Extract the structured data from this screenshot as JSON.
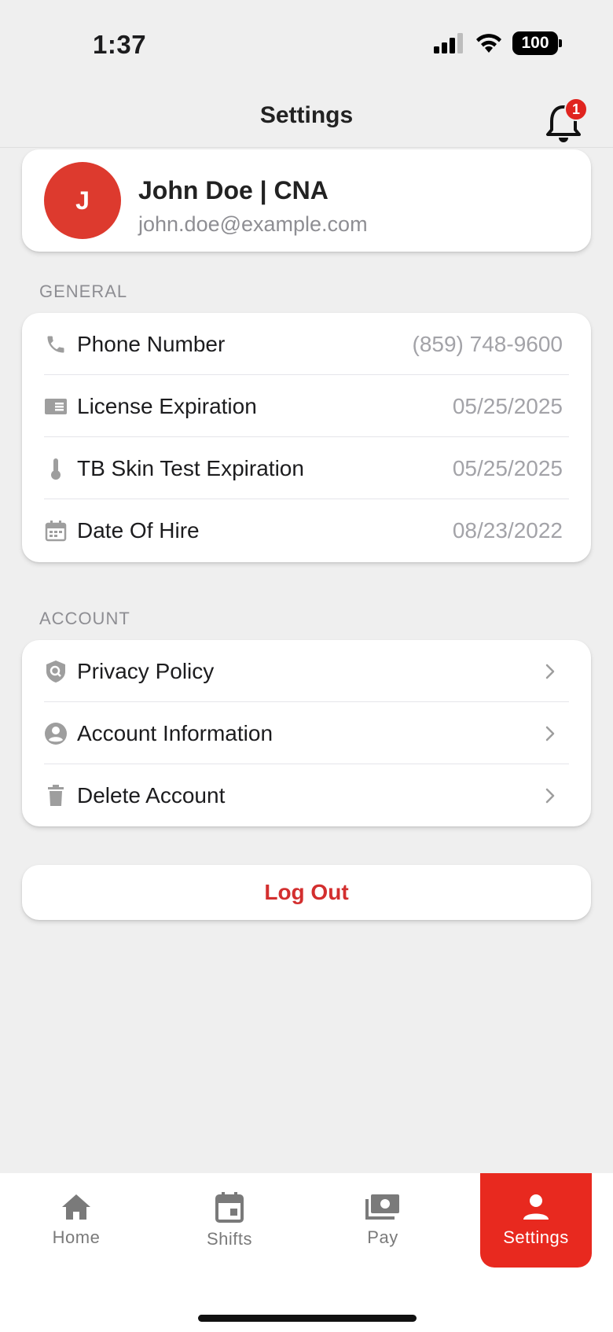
{
  "status_bar": {
    "time": "1:37",
    "battery": "100"
  },
  "header": {
    "title": "Settings",
    "notification_count": "1"
  },
  "profile": {
    "initial": "J",
    "name": "John Doe | CNA",
    "email": "john.doe@example.com"
  },
  "general": {
    "label": "GENERAL",
    "items": [
      {
        "icon": "phone-icon",
        "label": "Phone Number",
        "value": "(859) 748-9600"
      },
      {
        "icon": "license-card-icon",
        "label": "License Expiration",
        "value": "05/25/2025"
      },
      {
        "icon": "thermometer-icon",
        "label": "TB Skin Test Expiration",
        "value": "05/25/2025"
      },
      {
        "icon": "calendar-icon",
        "label": "Date Of Hire",
        "value": "08/23/2022"
      }
    ]
  },
  "account": {
    "label": "ACCOUNT",
    "items": [
      {
        "icon": "privacy-shield-icon",
        "label": "Privacy Policy"
      },
      {
        "icon": "account-circle-icon",
        "label": "Account Information"
      },
      {
        "icon": "trash-icon",
        "label": "Delete Account"
      }
    ]
  },
  "logout": {
    "label": "Log Out"
  },
  "tabs": [
    {
      "icon": "home-icon",
      "label": "Home",
      "active": false
    },
    {
      "icon": "calendar-icon",
      "label": "Shifts",
      "active": false
    },
    {
      "icon": "money-icon",
      "label": "Pay",
      "active": false
    },
    {
      "icon": "person-icon",
      "label": "Settings",
      "active": true
    }
  ],
  "colors": {
    "accent": "#e8291f",
    "avatar": "#dd3a2e",
    "logout_text": "#d32f2f",
    "background": "#efefef"
  }
}
